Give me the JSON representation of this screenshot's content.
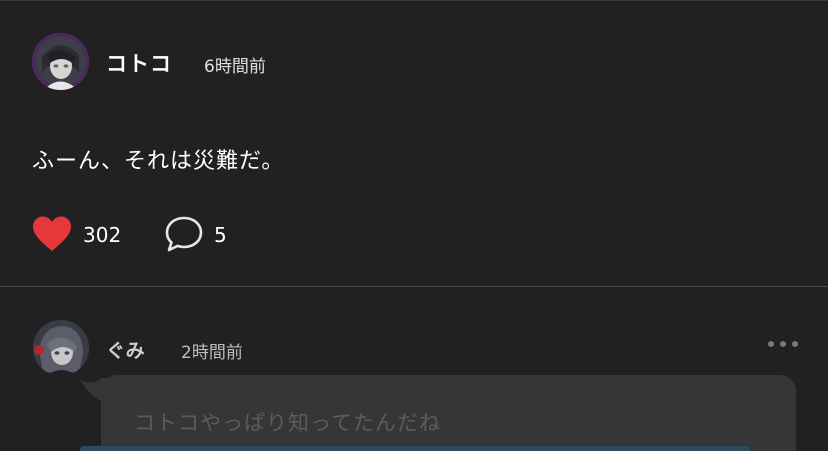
{
  "post": {
    "username": "コトコ",
    "timestamp": "6時間前",
    "body": "ふーん、それは災難だ。",
    "like_count": "302",
    "comment_count": "5"
  },
  "reply": {
    "username": "ぐみ",
    "timestamp": "2時間前",
    "text": "コトコやっぱり知ってたんだね"
  },
  "colors": {
    "background": "#212121",
    "heart": "#e5383b",
    "bubble": "#363636",
    "divider": "#4a4a4a"
  },
  "icons": {
    "like": "heart-icon",
    "comment": "speech-bubble-icon",
    "more": "ellipsis-icon"
  }
}
